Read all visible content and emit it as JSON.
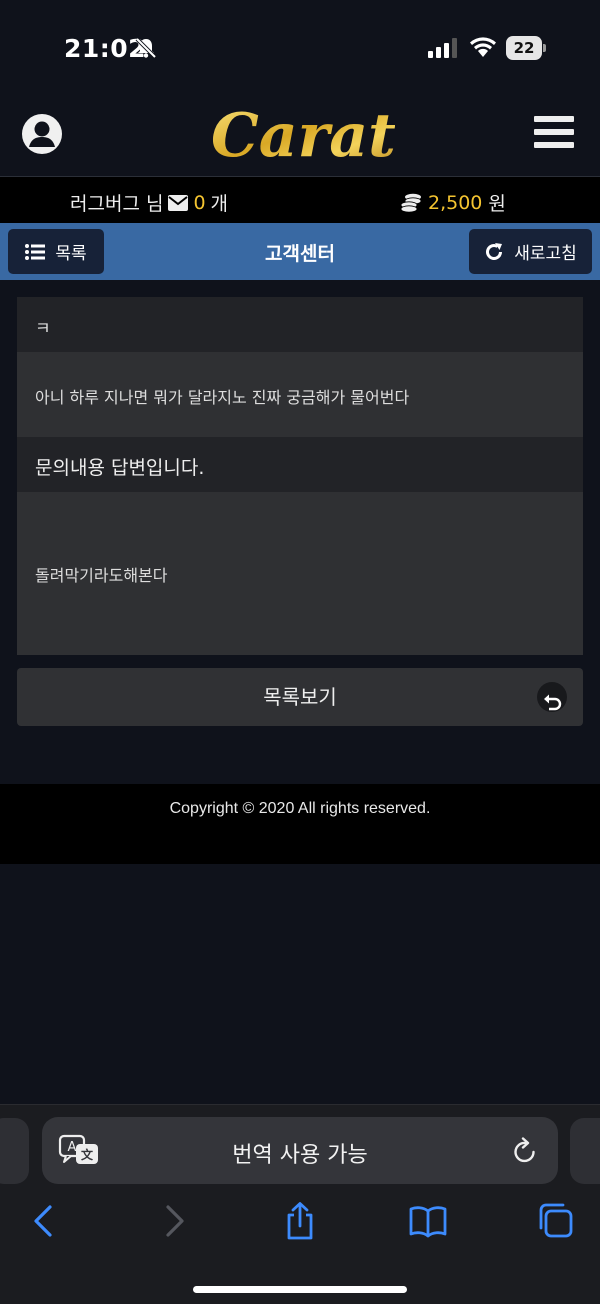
{
  "status_bar": {
    "time": "21:02",
    "battery": "22"
  },
  "header": {
    "logo_text": "Carat"
  },
  "info_bar": {
    "username": "러그버그 님",
    "mail_count": "0",
    "mail_unit": "개",
    "points": "2,500",
    "points_unit": "원"
  },
  "title_bar": {
    "list_button": "목록",
    "title": "고객센터",
    "refresh_button": "새로고침"
  },
  "inquiry": {
    "title": "ㅋ",
    "body": "아니 하루 지나면 뭐가 달라지노 진짜 궁금해가 물어번다"
  },
  "answer": {
    "title": "문의내용 답변입니다.",
    "body": "돌려막기라도해본다"
  },
  "back_button": "목록보기",
  "footer": {
    "copyright": "Copyright © 2020 All rights reserved."
  },
  "safari": {
    "address_text": "번역 사용 가능"
  },
  "colors": {
    "accent_gold": "#f4c430",
    "title_bar_blue": "#3969a3",
    "button_navy": "#172238",
    "ios_blue": "#3d8bfd"
  }
}
